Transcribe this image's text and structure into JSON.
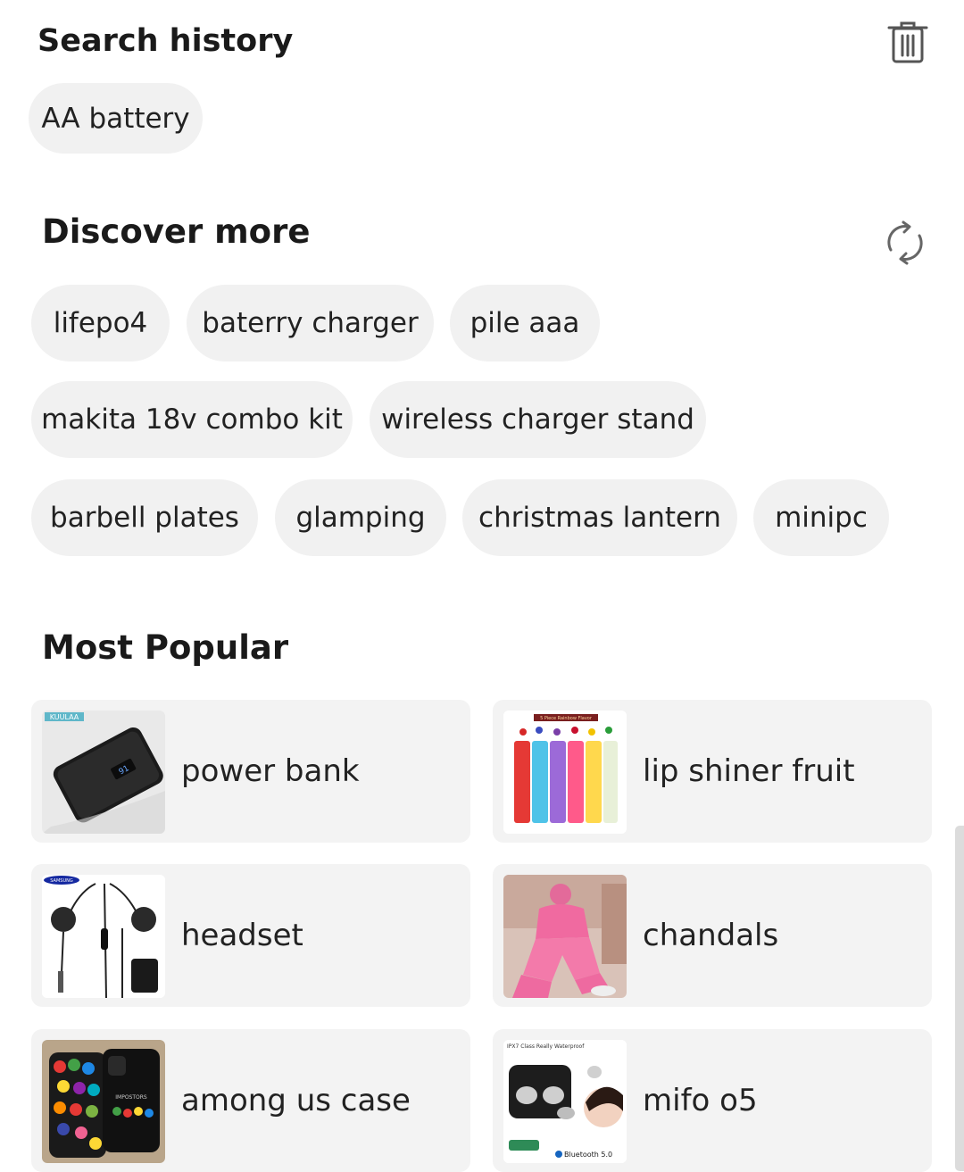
{
  "search_history": {
    "title": "Search history",
    "clear_icon": "trash-icon",
    "items": [
      "AA battery"
    ]
  },
  "discover_more": {
    "title": "Discover more",
    "refresh_icon": "refresh-icon",
    "chips": [
      "lifepo4",
      "baterry charger",
      "pile aaa",
      "makita 18v combo kit",
      "wireless charger stand",
      "barbell plates",
      "glamping",
      "christmas lantern",
      "minipc"
    ]
  },
  "most_popular": {
    "title": "Most Popular",
    "items": [
      {
        "label": "power bank",
        "thumb_text": "KUULAA"
      },
      {
        "label": "lip shiner fruit",
        "thumb_text": "5 Piece Rainbow Flavor"
      },
      {
        "label": "headset",
        "thumb_text": "SAMSUNG"
      },
      {
        "label": "chandals",
        "thumb_text": ""
      },
      {
        "label": "among us case",
        "thumb_text": "IMPOSTORS"
      },
      {
        "label": "mifo o5",
        "thumb_text": "IPX7 Class Really Waterproof",
        "thumb_text_2": "Bluetooth 5.0"
      }
    ]
  }
}
